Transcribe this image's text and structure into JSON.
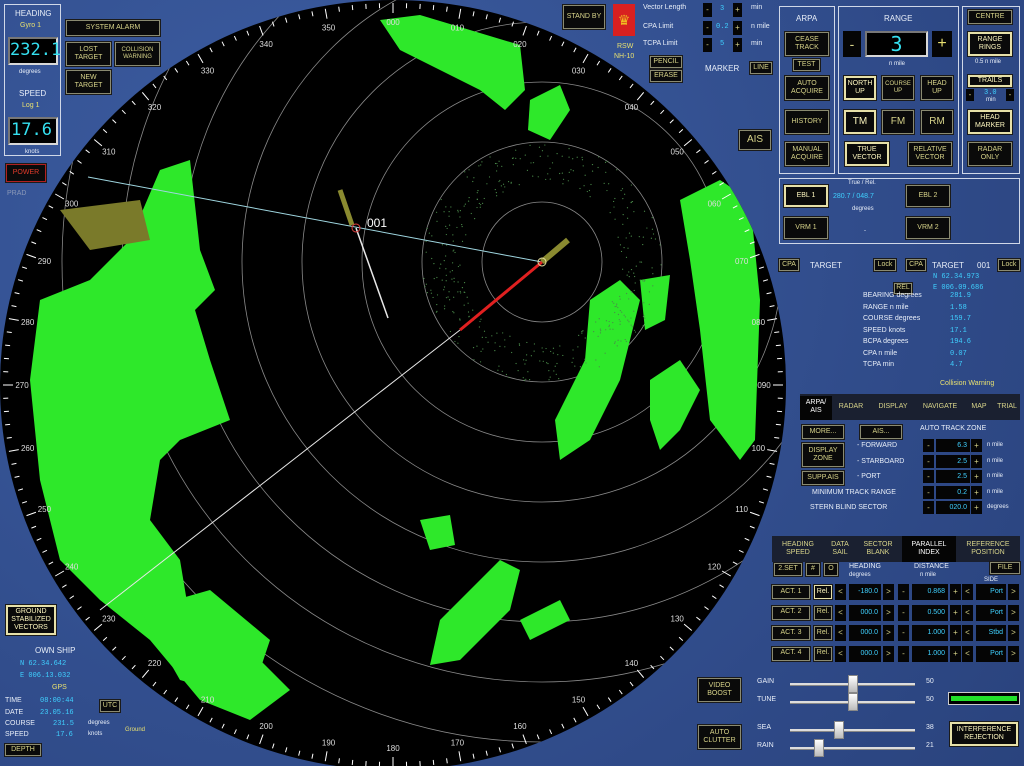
{
  "heading_panel": {
    "title": "HEADING",
    "source": "Gyro 1",
    "value": "232.1",
    "unit": "degrees"
  },
  "speed_panel": {
    "title": "SPEED",
    "source": "Log 1",
    "value": "17.6",
    "unit": "knots"
  },
  "alarms": {
    "system_alarm": "SYSTEM ALARM",
    "lost_target": "LOST TARGET",
    "collision_warning": "COLLISION WARNING",
    "new_target": "NEW TARGET"
  },
  "power": {
    "label": "POWER",
    "prad": "PRAD"
  },
  "standby": "STAND BY",
  "logo": {
    "line1": "RSW",
    "line2": "NH-10"
  },
  "vectors": {
    "vector_length": {
      "label": "Vector Length",
      "value": "3",
      "unit": "min"
    },
    "cpa_limit": {
      "label": "CPA Limit",
      "value": "0.2",
      "unit": "n mile"
    },
    "tcpa_limit": {
      "label": "TCPA Limit",
      "value": "5",
      "unit": "min"
    }
  },
  "pencil": "PENCIL",
  "erase": "ERASE",
  "marker": {
    "label": "MARKER",
    "button": "LINE"
  },
  "ais_button": "AIS",
  "arpa": {
    "title": "ARPA",
    "cease_track": "CEASE TRACK",
    "test": "TEST",
    "auto_acquire": "AUTO ACQUIRE",
    "history": "HISTORY",
    "manual_acquire": "MANUAL ACQUIRE"
  },
  "range": {
    "title": "RANGE",
    "value": "3",
    "unit": "n mile",
    "minus": "-",
    "plus": "+",
    "modes": [
      "NORTH UP",
      "COURSE UP",
      "HEAD UP"
    ],
    "motion": [
      "TM",
      "FM",
      "RM"
    ],
    "true_vector": "TRUE VECTOR",
    "relative_vector": "RELATIVE VECTOR"
  },
  "right_col": {
    "centre": "CENTRE",
    "range_rings": "RANGE RINGS",
    "rings_spacing": "0.5 n mile",
    "trails": "TRAILS",
    "trails_value": "3.0",
    "trails_unit": "min",
    "head_marker": "HEAD MARKER",
    "radar_only": "RADAR ONLY"
  },
  "ebl": {
    "ebl1": "EBL 1",
    "ebl2": "EBL 2",
    "vrm1": "VRM 1",
    "vrm2": "VRM 2",
    "header": "True / Rel.",
    "value": "280.7 / 048.7",
    "unit": "degrees",
    "vrm_value": "-"
  },
  "target_left": {
    "cpa": "CPA",
    "label": "TARGET",
    "lock": "Lock"
  },
  "target_right": {
    "cpa": "CPA",
    "label": "TARGET",
    "id": "001",
    "lock": "Lock",
    "lat": "N  62.34.973",
    "lon": "E 006.09.686",
    "rel": "REL",
    "rows": [
      {
        "label": "BEARING degrees",
        "value": "281.9"
      },
      {
        "label": "RANGE n mile",
        "value": "1.58"
      },
      {
        "label": "COURSE degrees",
        "value": "159.7"
      },
      {
        "label": "SPEED knots",
        "value": "17.1"
      },
      {
        "label": "BCPA degrees",
        "value": "194.6"
      },
      {
        "label": "CPA n mile",
        "value": "0.07"
      },
      {
        "label": "TCPA min",
        "value": "4.7"
      }
    ],
    "warning": "Collision Warning"
  },
  "tabs1": [
    "ARPA/ AIS",
    "RADAR",
    "DISPLAY",
    "NAVIGATE",
    "MAP",
    "TRIAL"
  ],
  "arpa_ais": {
    "more": "MORE...",
    "ais": "AIS...",
    "display_zone": "DISPLAY ZONE",
    "supp_ais": "SUPP.AIS",
    "zone_title": "AUTO TRACK ZONE",
    "rows": [
      {
        "label": "- FORWARD",
        "value": "6.3",
        "unit": "n mile"
      },
      {
        "label": "- STARBOARD",
        "value": "2.5",
        "unit": "n mile"
      },
      {
        "label": "- PORT",
        "value": "2.5",
        "unit": "n mile"
      },
      {
        "label": "MINIMUM TRACK RANGE",
        "value": "0.2",
        "unit": "n mile"
      },
      {
        "label": "STERN BLIND SECTOR",
        "value": "020.0",
        "unit": "degrees"
      }
    ]
  },
  "tabs2": [
    "HEADING SPEED",
    "DATA SAIL",
    "SECTOR BLANK",
    "PARALLEL INDEX",
    "REFERENCE POSITION"
  ],
  "pi": {
    "set": "2.SET",
    "hash": "#",
    "circle": "O",
    "heading_hdr": "HEADING",
    "heading_unit": "degrees",
    "distance_hdr": "DISTANCE",
    "distance_unit": "n mile",
    "file": "FILE",
    "side_hdr": "SIDE",
    "rows": [
      {
        "act": "ACT. 1",
        "rel": "Rel.",
        "heading": "-180.0",
        "distance": "0.868",
        "side": "Port"
      },
      {
        "act": "ACT. 2",
        "rel": "Rel.",
        "heading": "000.0",
        "distance": "0.500",
        "side": "Port"
      },
      {
        "act": "ACT. 3",
        "rel": "Rel.",
        "heading": "000.0",
        "distance": "1.000",
        "side": "Stbd"
      },
      {
        "act": "ACT. 4",
        "rel": "Rel.",
        "heading": "000.0",
        "distance": "1.000",
        "side": "Port"
      }
    ]
  },
  "controls": {
    "video_boost": "VIDEO BOOST",
    "auto_clutter": "AUTO CLUTTER",
    "interference": "INTERFERENCE REJECTION",
    "sliders": [
      {
        "label": "GAIN",
        "value": 50
      },
      {
        "label": "TUNE",
        "value": 50
      },
      {
        "label": "SEA",
        "value": 38
      },
      {
        "label": "RAIN",
        "value": 21
      }
    ],
    "tune_indicator_color": "#22e02a"
  },
  "ground_stab": "GROUND STABILIZED VECTORS",
  "own_ship": {
    "title": "OWN SHIP",
    "lat": "N  62.34.642",
    "lon": "E 006.13.032",
    "source": "GPS",
    "time_label": "TIME",
    "time": "08:00:44",
    "date_label": "DATE",
    "date": "23.05.16",
    "course_label": "COURSE",
    "course": "231.5",
    "course_unit": "degrees",
    "speed_label": "SPEED",
    "speed": "17.6",
    "speed_unit": "knots",
    "utc": "UTC",
    "ground": "Ground",
    "depth": "DEPTH"
  },
  "radar": {
    "target_id": "001",
    "bearing_labels": [
      "000",
      "010",
      "020",
      "030",
      "040",
      "050",
      "060",
      "070",
      "080",
      "090",
      "100",
      "110",
      "120",
      "130",
      "140",
      "150",
      "160",
      "170",
      "180",
      "190",
      "200",
      "210",
      "220",
      "230",
      "240",
      "250",
      "260",
      "270",
      "280",
      "290",
      "300",
      "310",
      "320",
      "330",
      "340",
      "350"
    ],
    "colors": {
      "echo": "#2ee82a",
      "trail": "#7a7a2a",
      "ebl": "#9fd6e0",
      "vector_red": "#e02020"
    }
  }
}
